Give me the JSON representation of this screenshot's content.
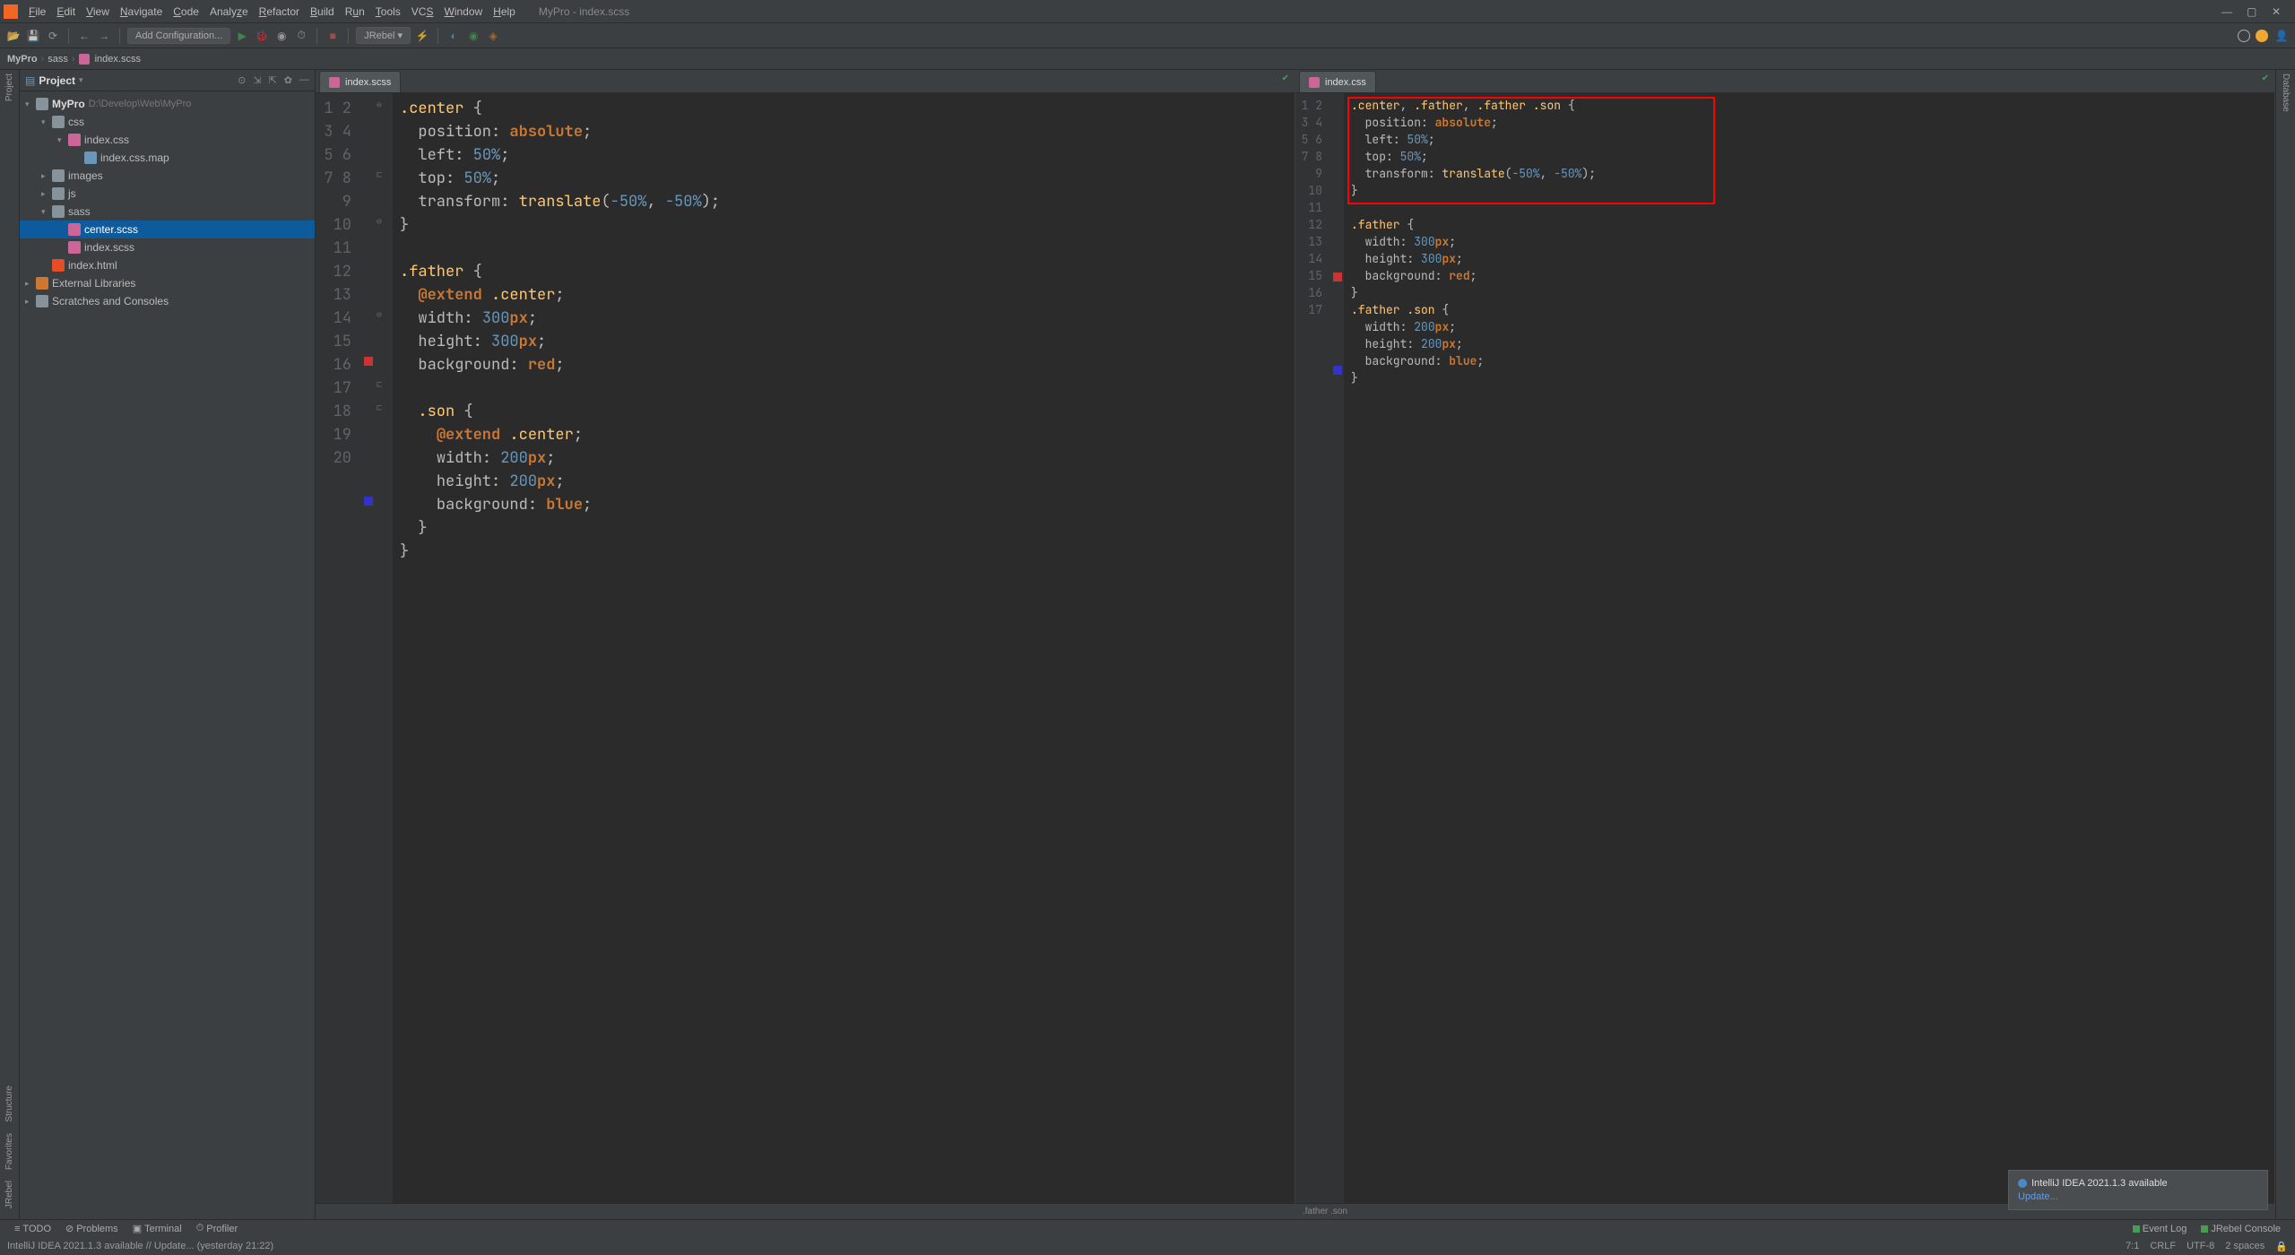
{
  "window": {
    "title": "MyPro - index.scss"
  },
  "menu": [
    "File",
    "Edit",
    "View",
    "Navigate",
    "Code",
    "Analyze",
    "Refactor",
    "Build",
    "Run",
    "Tools",
    "VCS",
    "Window",
    "Help"
  ],
  "toolbar": {
    "config": "Add Configuration...",
    "jrebel": "JRebel"
  },
  "breadcrumb": {
    "project": "MyPro",
    "folder": "sass",
    "file": "index.scss"
  },
  "project": {
    "label": "Project",
    "root": "MyPro",
    "root_path": "D:\\Develop\\Web\\MyPro",
    "tree": {
      "css": "css",
      "index_css": "index.css",
      "index_css_map": "index.css.map",
      "images": "images",
      "js": "js",
      "sass": "sass",
      "center_scss": "center.scss",
      "index_scss": "index.scss",
      "index_html": "index.html",
      "ext_libs": "External Libraries",
      "scratches": "Scratches and Consoles"
    }
  },
  "tabs": {
    "left": "index.scss",
    "right": "index.css"
  },
  "left_code": {
    "lines": [
      "1",
      "2",
      "3",
      "4",
      "5",
      "6",
      "7",
      "8",
      "9",
      "10",
      "11",
      "12",
      "13",
      "14",
      "15",
      "16",
      "17",
      "18",
      "19",
      "20"
    ]
  },
  "right_code": {
    "lines": [
      "1",
      "2",
      "3",
      "4",
      "5",
      "6",
      "7",
      "8",
      "9",
      "10",
      "11",
      "12",
      "13",
      "14",
      "15",
      "16",
      "17"
    ]
  },
  "right_breadcrumb": ".father .son",
  "status": {
    "todo": "TODO",
    "problems": "Problems",
    "terminal": "Terminal",
    "profiler": "Profiler",
    "event_log": "Event Log",
    "jrebel_console": "JRebel Console"
  },
  "info_bar": {
    "msg": "IntelliJ IDEA 2021.1.3 available // Update... (yesterday 21:22)",
    "pos": "7:1",
    "crlf": "CRLF",
    "enc": "UTF-8",
    "indent": "2 spaces"
  },
  "notification": {
    "title": "IntelliJ IDEA 2021.1.3 available",
    "link": "Update..."
  },
  "side_tools": {
    "project": "Project",
    "structure": "Structure",
    "favorites": "Favorites",
    "jrebel": "JRebel",
    "database": "Database"
  }
}
